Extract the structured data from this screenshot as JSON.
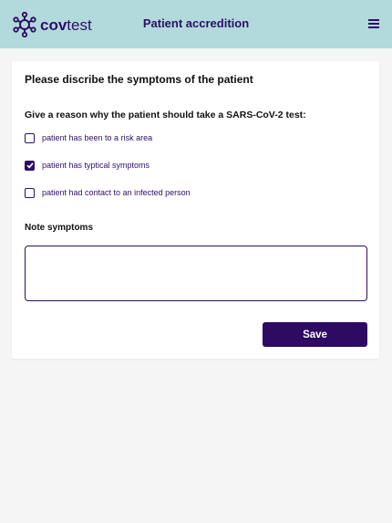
{
  "header": {
    "logo_text_bold": "cov",
    "logo_text_light": "test",
    "title": "Patient accredition",
    "menu_icon": "hamburger-menu-icon"
  },
  "card": {
    "title": "Please discribe the symptoms of the patient",
    "question": "Give a reason why the patient should take a SARS-CoV-2 test:",
    "options": [
      {
        "label": "patient has been to a risk area",
        "checked": false
      },
      {
        "label": "patient has typtical symptoms",
        "checked": true
      },
      {
        "label": "patient had contact to an infected person",
        "checked": false
      }
    ],
    "note_label": "Note symptoms",
    "note_value": "",
    "save_label": "Save"
  },
  "colors": {
    "header_bg": "#b2d9dc",
    "primary": "#2e0f67",
    "button_bg": "#2e0a63",
    "page_bg": "#f5f5f5"
  }
}
